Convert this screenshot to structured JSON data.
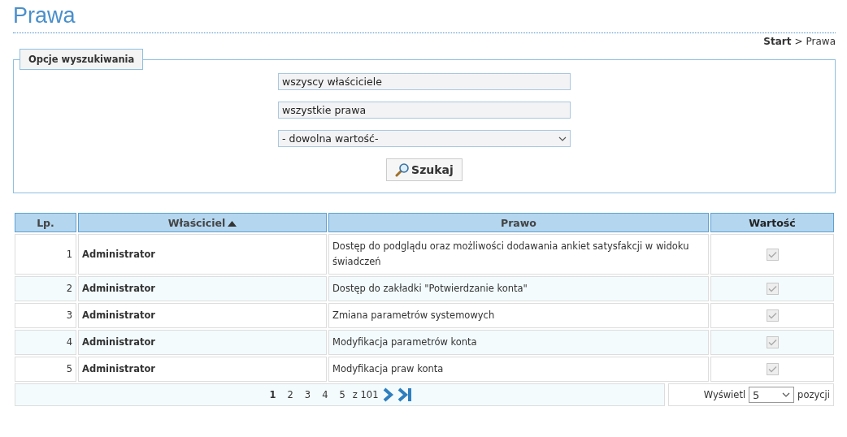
{
  "page_title": "Prawa",
  "breadcrumb": [
    {
      "label": "Start",
      "kind": "link"
    },
    {
      "label": ">",
      "kind": "separator"
    },
    {
      "label": "Prawa",
      "kind": "current"
    }
  ],
  "search": {
    "legend": "Opcje wyszukiwania",
    "fields": [
      {
        "kind": "text",
        "value": "wszyscy właściciele"
      },
      {
        "kind": "text",
        "value": "wszystkie prawa"
      },
      {
        "kind": "select",
        "value": "- dowolna wartość-"
      }
    ],
    "button": "Szukaj"
  },
  "table": {
    "columns": [
      {
        "label": "Lp.",
        "sorted": false
      },
      {
        "label": "Właściciel",
        "sorted": true
      },
      {
        "label": "Prawo",
        "sorted": false
      },
      {
        "label": "Wartość",
        "sorted": false
      }
    ],
    "rows": [
      {
        "lp": "1",
        "owner": "Administrator",
        "right": "Dostęp do podglądu oraz możliwości dodawania ankiet satysfakcji w widoku świadczeń",
        "checked": true,
        "disabled": true
      },
      {
        "lp": "2",
        "owner": "Administrator",
        "right": "Dostęp do zakładki \"Potwierdzanie konta\"",
        "checked": true,
        "disabled": true
      },
      {
        "lp": "3",
        "owner": "Administrator",
        "right": "Zmiana parametrów systemowych",
        "checked": true,
        "disabled": true
      },
      {
        "lp": "4",
        "owner": "Administrator",
        "right": "Modyfikacja parametrów konta",
        "checked": true,
        "disabled": true
      },
      {
        "lp": "5",
        "owner": "Administrator",
        "right": "Modyfikacja praw konta",
        "checked": true,
        "disabled": true
      }
    ]
  },
  "pagination": {
    "pages": [
      {
        "label": "1",
        "selected": true
      },
      {
        "label": "2",
        "selected": false
      },
      {
        "label": "3",
        "selected": false
      },
      {
        "label": "4",
        "selected": false
      },
      {
        "label": "5",
        "selected": false
      }
    ],
    "total": "z 101",
    "show_label": "Wyświetl",
    "per_page": "5",
    "suffix": "pozycji"
  }
}
